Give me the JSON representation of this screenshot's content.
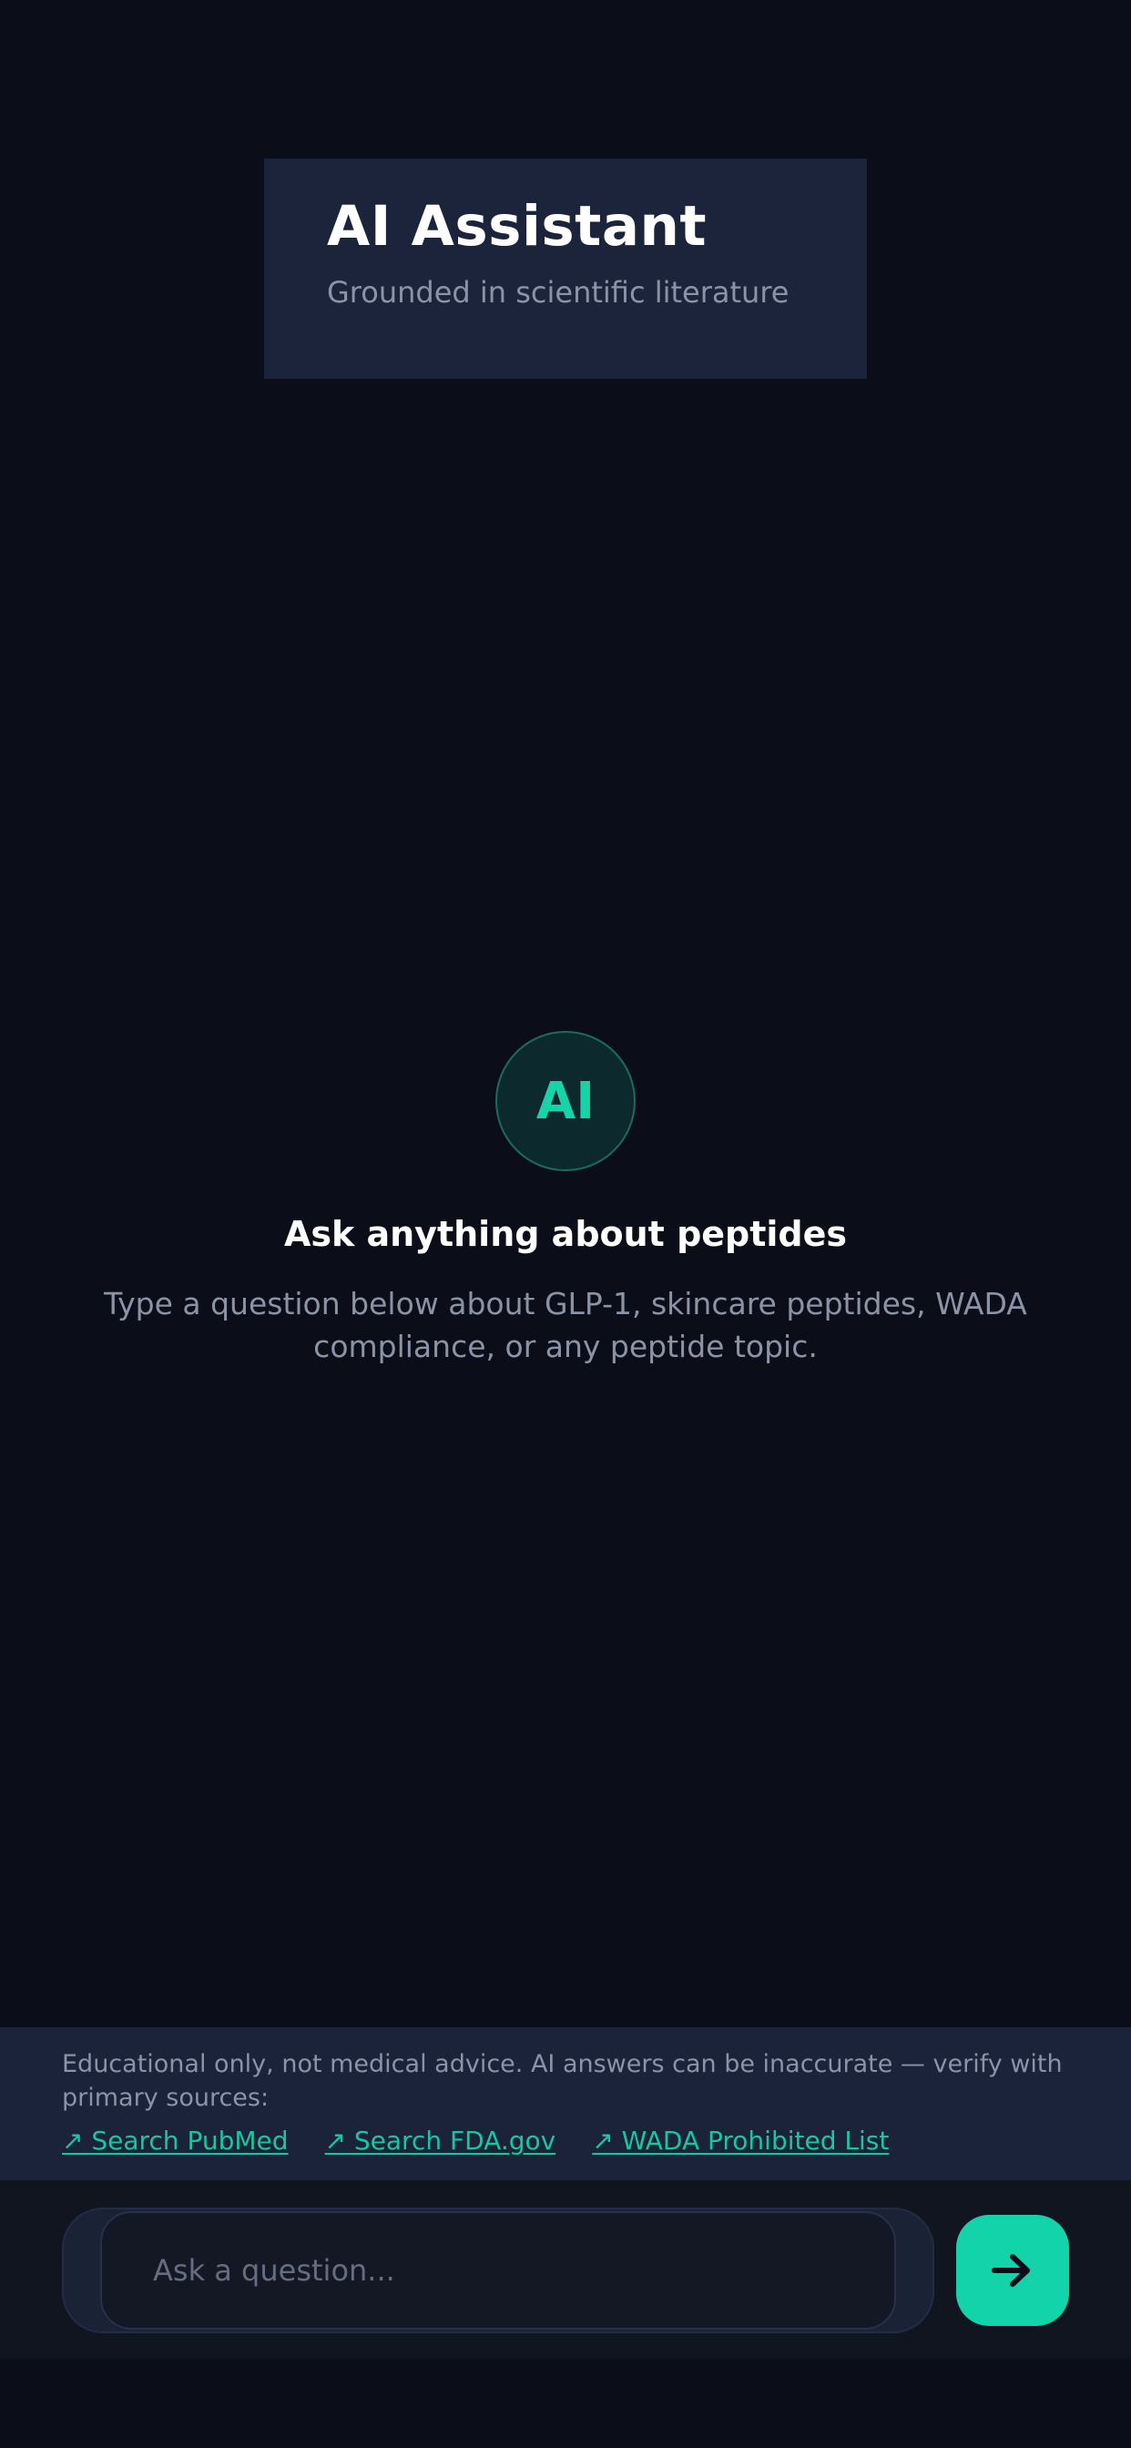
{
  "header": {
    "title": "AI Assistant",
    "subtitle": "Grounded in scientific literature"
  },
  "empty_state": {
    "avatar_label": "AI",
    "title": "Ask anything about peptides",
    "description": "Type a question below about GLP-1, skincare peptides, WADA compliance, or any peptide topic."
  },
  "disclaimer": {
    "text": "Educational only, not medical advice. AI answers can be inaccurate — verify with primary sources:",
    "links": [
      {
        "label": "↗ Search PubMed"
      },
      {
        "label": "↗ Search FDA.gov"
      },
      {
        "label": "↗ WADA Prohibited List"
      }
    ]
  },
  "composer": {
    "placeholder": "Ask a question...",
    "send_icon": "arrow-right-icon"
  },
  "colors": {
    "background": "#0b0e18",
    "card": "#1c243b",
    "accent": "#12d3aa",
    "muted_text": "#8b93a6"
  }
}
